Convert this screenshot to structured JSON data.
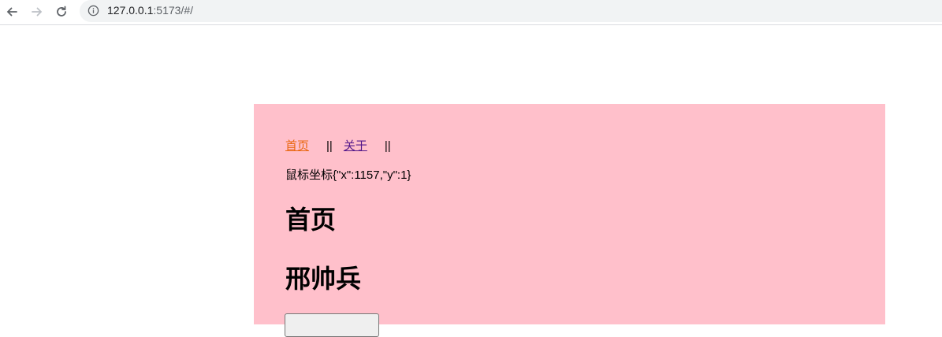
{
  "browser": {
    "url_host": "127.0.0.1",
    "url_rest": ":5173/#/",
    "icons": [
      "back-arrow-icon",
      "forward-arrow-icon",
      "reload-icon",
      "info-icon"
    ]
  },
  "nav": {
    "home": "首页",
    "separator": "||",
    "about": "关于"
  },
  "mouse": {
    "text": "鼠标坐标{\"x\":1157,\"y\":1}"
  },
  "page": {
    "title": "首页",
    "name": "邢帅兵"
  },
  "colors": {
    "app_bg": "#ffc0cb",
    "link_active": "#e9650c",
    "link_visited": "#551a8b"
  }
}
